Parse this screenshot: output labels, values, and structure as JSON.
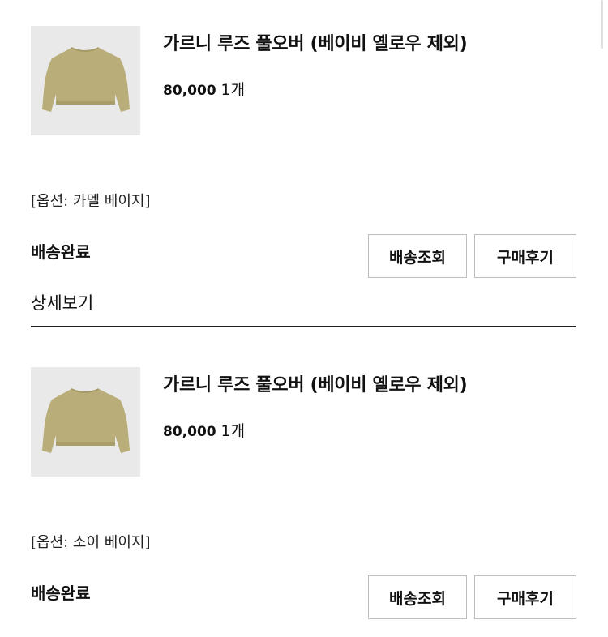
{
  "orders": [
    {
      "product_name": "가르니 루즈 풀오버 (베이비 옐로우 제외)",
      "price": "80,000",
      "quantity": "1개",
      "option": "[옵션: 카멜 베이지]",
      "status": "배송완료",
      "track_button": "배송조회",
      "review_button": "구매후기",
      "detail_link": "상세보기"
    },
    {
      "product_name": "가르니 루즈 풀오버 (베이비 옐로우 제외)",
      "price": "80,000",
      "quantity": "1개",
      "option": "[옵션: 소이 베이지]",
      "status": "배송완료",
      "track_button": "배송조회",
      "review_button": "구매후기"
    }
  ],
  "colors": {
    "sweater": "#b9ad7a",
    "thumbnail_bg": "#e9e9e9",
    "button_border": "#bdbdbd",
    "divider": "#222222"
  },
  "icons": {
    "product_image": "sweater-image"
  }
}
